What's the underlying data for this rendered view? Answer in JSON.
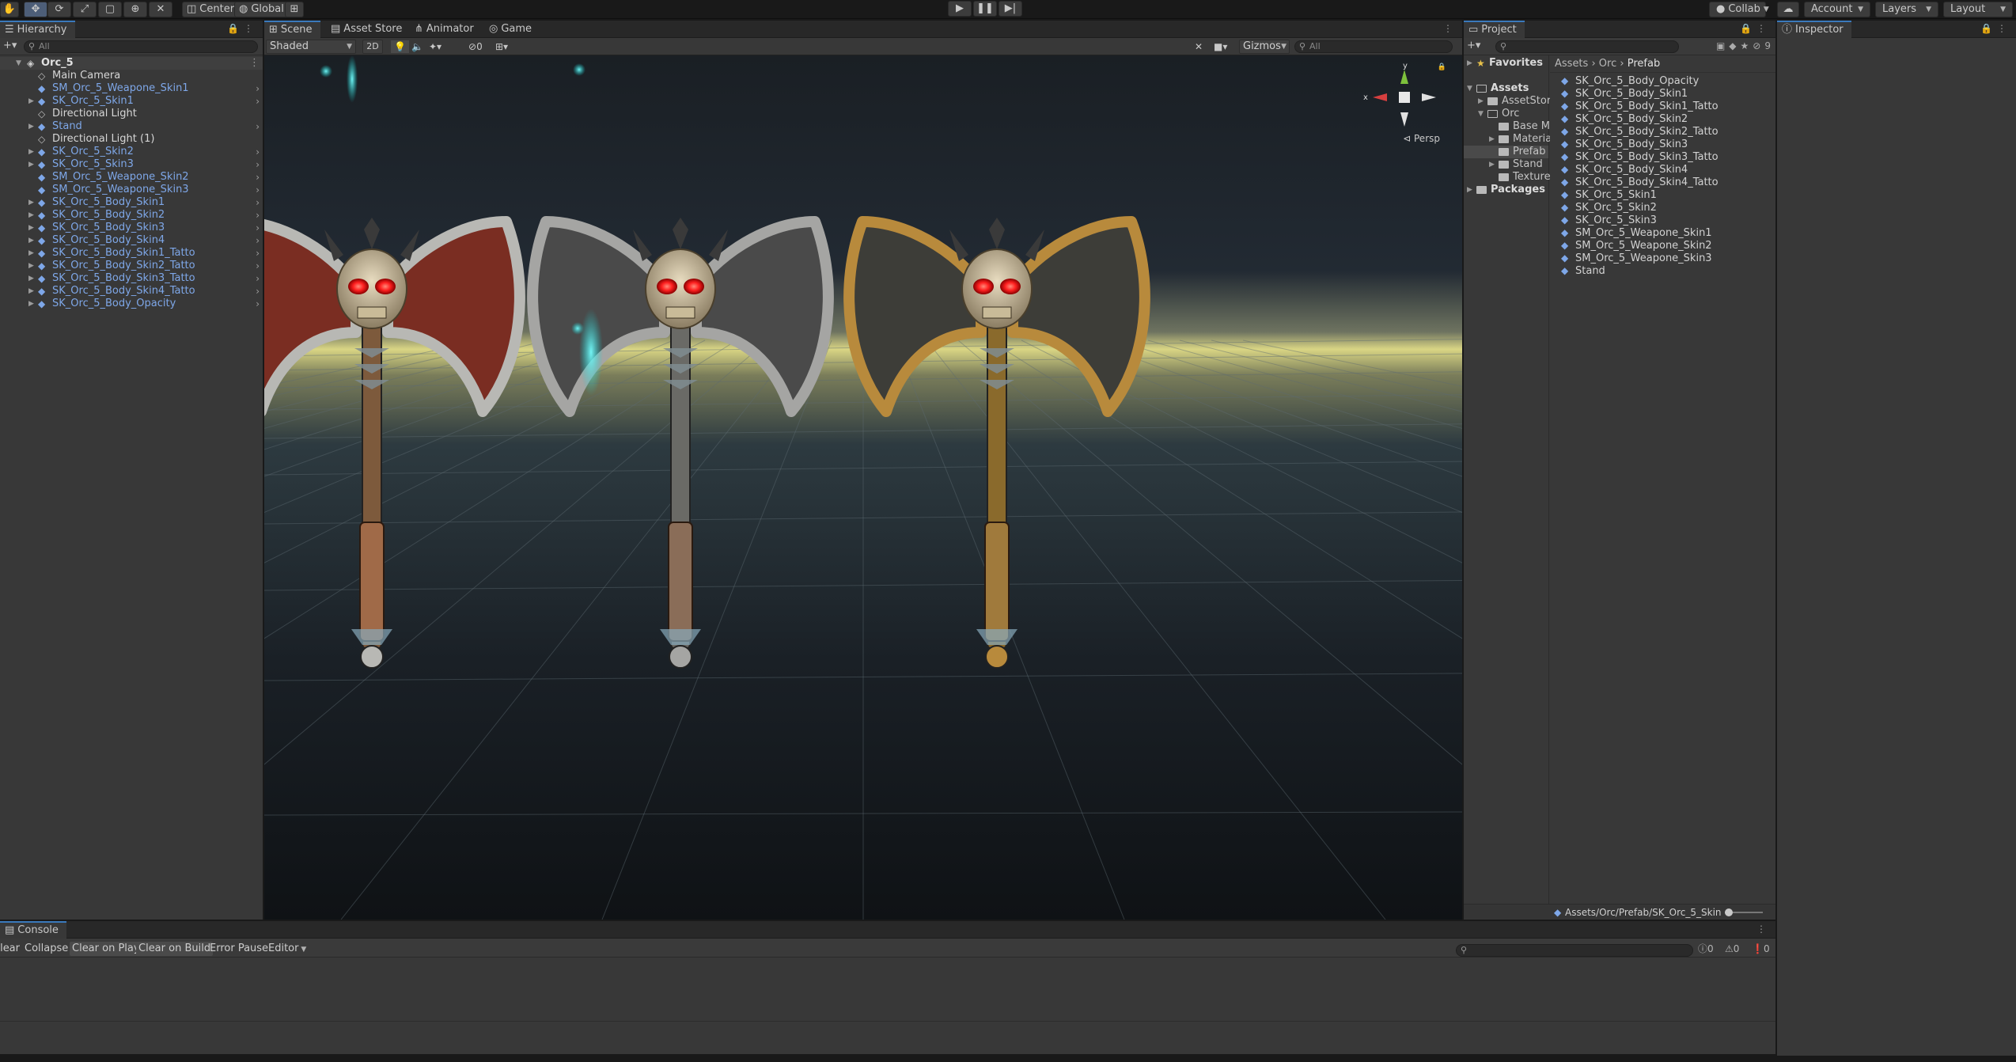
{
  "toolbar": {
    "tools": [
      "hand-tool",
      "move-tool",
      "rotate-tool",
      "scale-tool",
      "rect-tool",
      "transform-tool",
      "custom-tool"
    ],
    "pivot_label": "Center",
    "space_label": "Global",
    "collab_label": "Collab",
    "account_label": "Account",
    "layers_label": "Layers",
    "layout_label": "Layout"
  },
  "hierarchy": {
    "tab_label": "Hierarchy",
    "search_placeholder": "All",
    "root": "Orc_5",
    "items": [
      {
        "label": "Main Camera",
        "type": "gameobject",
        "prefab": false,
        "expandable": false
      },
      {
        "label": "SM_Orc_5_Weapone_Skin1",
        "type": "prefab",
        "prefab": true,
        "expandable": false
      },
      {
        "label": "SK_Orc_5_Skin1",
        "type": "prefab",
        "prefab": true,
        "expandable": true
      },
      {
        "label": "Directional Light",
        "type": "gameobject",
        "prefab": false,
        "expandable": false
      },
      {
        "label": "Stand",
        "type": "prefab",
        "prefab": true,
        "expandable": true
      },
      {
        "label": "Directional Light (1)",
        "type": "gameobject",
        "prefab": false,
        "expandable": false
      },
      {
        "label": "SK_Orc_5_Skin2",
        "type": "prefab",
        "prefab": true,
        "expandable": true
      },
      {
        "label": "SK_Orc_5_Skin3",
        "type": "prefab",
        "prefab": true,
        "expandable": true
      },
      {
        "label": "SM_Orc_5_Weapone_Skin2",
        "type": "prefab",
        "prefab": true,
        "expandable": false
      },
      {
        "label": "SM_Orc_5_Weapone_Skin3",
        "type": "prefab",
        "prefab": true,
        "expandable": false
      },
      {
        "label": "SK_Orc_5_Body_Skin1",
        "type": "prefab",
        "prefab": true,
        "expandable": true
      },
      {
        "label": "SK_Orc_5_Body_Skin2",
        "type": "prefab",
        "prefab": true,
        "expandable": true
      },
      {
        "label": "SK_Orc_5_Body_Skin3",
        "type": "prefab",
        "prefab": true,
        "expandable": true
      },
      {
        "label": "SK_Orc_5_Body_Skin4",
        "type": "prefab",
        "prefab": true,
        "expandable": true
      },
      {
        "label": "SK_Orc_5_Body_Skin1_Tatto",
        "type": "prefab",
        "prefab": true,
        "expandable": true
      },
      {
        "label": "SK_Orc_5_Body_Skin2_Tatto",
        "type": "prefab",
        "prefab": true,
        "expandable": true
      },
      {
        "label": "SK_Orc_5_Body_Skin3_Tatto",
        "type": "prefab",
        "prefab": true,
        "expandable": true
      },
      {
        "label": "SK_Orc_5_Body_Skin4_Tatto",
        "type": "prefab",
        "prefab": true,
        "expandable": true
      },
      {
        "label": "SK_Orc_5_Body_Opacity",
        "type": "prefab",
        "prefab": true,
        "expandable": true
      }
    ]
  },
  "scene": {
    "tabs": [
      "Scene",
      "Asset Store",
      "Animator",
      "Game"
    ],
    "active_tab": "Scene",
    "shading_mode": "Shaded",
    "mode_2d": "2D",
    "hidden_count": "0",
    "gizmos_label": "Gizmos",
    "search_placeholder": "All",
    "projection_label": "Persp",
    "axis_x": "x",
    "axis_y": "y",
    "weapons": [
      {
        "blade": "#7a2d22",
        "rim": "#b8b8b4",
        "shaft": "#7d5a3c",
        "grip": "#a06a48"
      },
      {
        "blade": "#4a4a4a",
        "rim": "#a5a5a3",
        "shaft": "#6a6a66",
        "grip": "#8a6d58"
      },
      {
        "blade": "#3d3d38",
        "rim": "#b88a3c",
        "shaft": "#8a6a2c",
        "grip": "#a07a3c"
      }
    ]
  },
  "project": {
    "tab_label": "Project",
    "count": "9",
    "favorites_label": "Favorites",
    "tree": [
      {
        "label": "Assets",
        "level": 0,
        "bold": true,
        "open": true
      },
      {
        "label": "AssetStore",
        "level": 1,
        "bold": false,
        "open": false
      },
      {
        "label": "Orc",
        "level": 1,
        "bold": false,
        "open": true
      },
      {
        "label": "Base Me",
        "level": 2,
        "bold": false,
        "open": false
      },
      {
        "label": "Material",
        "level": 2,
        "bold": false,
        "open": false
      },
      {
        "label": "Prefab",
        "level": 2,
        "bold": false,
        "open": false,
        "selected": true
      },
      {
        "label": "Stand",
        "level": 2,
        "bold": false,
        "open": false
      },
      {
        "label": "Textures",
        "level": 2,
        "bold": false,
        "open": false
      },
      {
        "label": "Packages",
        "level": 0,
        "bold": true,
        "open": false
      }
    ],
    "breadcrumb": [
      "Assets",
      "Orc",
      "Prefab"
    ],
    "files": [
      "SK_Orc_5_Body_Opacity",
      "SK_Orc_5_Body_Skin1",
      "SK_Orc_5_Body_Skin1_Tatto",
      "SK_Orc_5_Body_Skin2",
      "SK_Orc_5_Body_Skin2_Tatto",
      "SK_Orc_5_Body_Skin3",
      "SK_Orc_5_Body_Skin3_Tatto",
      "SK_Orc_5_Body_Skin4",
      "SK_Orc_5_Body_Skin4_Tatto",
      "SK_Orc_5_Skin1",
      "SK_Orc_5_Skin2",
      "SK_Orc_5_Skin3",
      "SM_Orc_5_Weapone_Skin1",
      "SM_Orc_5_Weapone_Skin2",
      "SM_Orc_5_Weapone_Skin3",
      "Stand"
    ],
    "path": "Assets/Orc/Prefab/SK_Orc_5_Skin"
  },
  "inspector": {
    "tab_label": "Inspector"
  },
  "console": {
    "tab_label": "Console",
    "buttons": [
      "Clear",
      "Collapse",
      "Clear on Play",
      "Clear on Build",
      "Error Pause",
      "Editor"
    ],
    "info_count": "0",
    "warning_count": "0",
    "error_count": "0"
  },
  "colors": {
    "accent": "#3a79bb",
    "prefab_blue": "#7ea7e8",
    "panel": "#383838",
    "background": "#191919"
  }
}
